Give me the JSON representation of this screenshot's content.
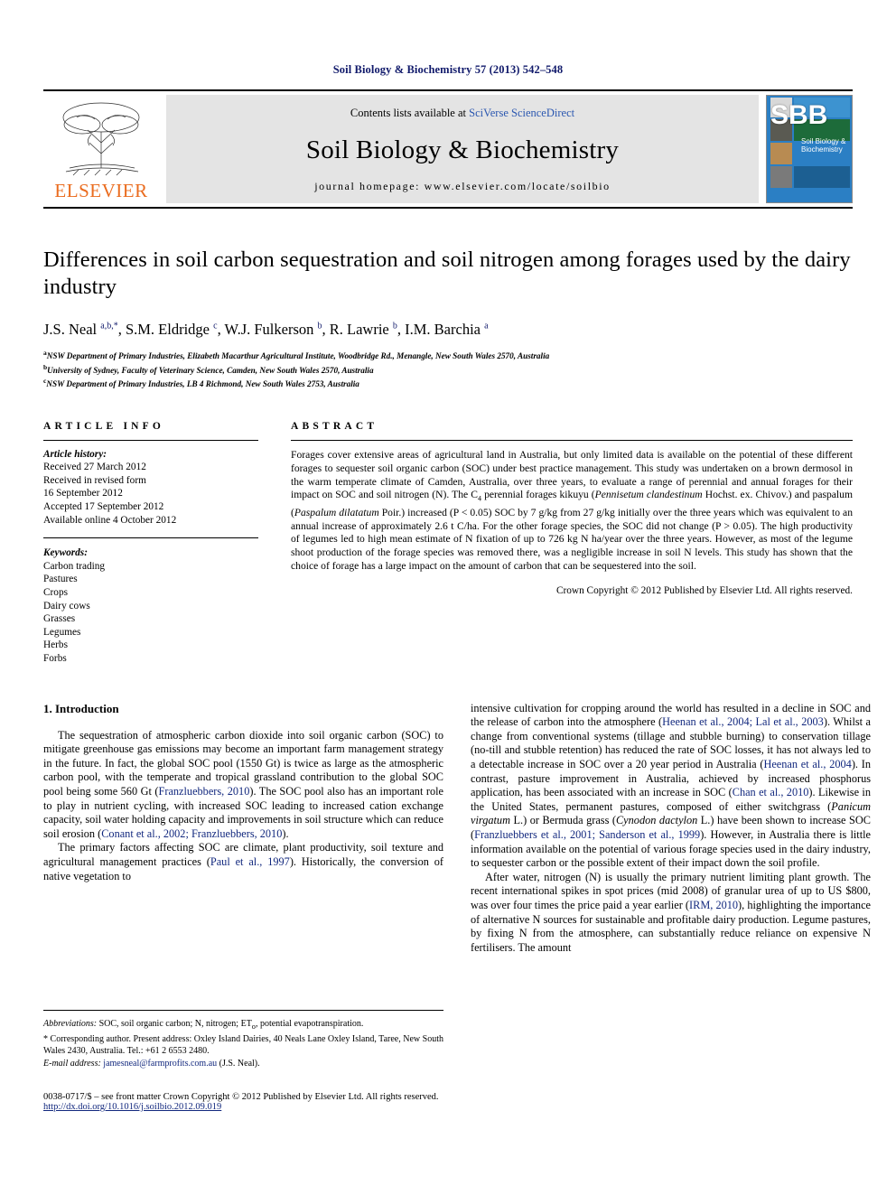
{
  "running_head": "Soil Biology & Biochemistry 57 (2013) 542–548",
  "masthead": {
    "publisher_name": "ELSEVIER",
    "publisher_logo_alt": "elsevier-tree-logo",
    "contents_prefix": "Contents lists available at ",
    "contents_link": "SciVerse ScienceDirect",
    "journal_name": "Soil Biology & Biochemistry",
    "homepage": "journal homepage: www.elsevier.com/locate/soilbio",
    "cover": {
      "initials": "SBB",
      "title_line1": "Soil Biology &",
      "title_line2": "Biochemistry"
    }
  },
  "article": {
    "title": "Differences in soil carbon sequestration and soil nitrogen among forages used by the dairy industry",
    "authors_html": "J.S. Neal <sup>a,b,</sup><sup>*</sup>, S.M. Eldridge <sup>c</sup>, W.J. Fulkerson <sup>b</sup>, R. Lawrie <sup>b</sup>, I.M. Barchia <sup>a</sup>",
    "affiliations": [
      {
        "marker": "a",
        "text": "NSW Department of Primary Industries, Elizabeth Macarthur Agricultural Institute, Woodbridge Rd., Menangle, New South Wales 2570, Australia"
      },
      {
        "marker": "b",
        "text": "University of Sydney, Faculty of Veterinary Science, Camden, New South Wales 2570, Australia"
      },
      {
        "marker": "c",
        "text": "NSW Department of Primary Industries, LB 4 Richmond, New South Wales 2753, Australia"
      }
    ]
  },
  "article_info": {
    "heading": "ARTICLE INFO",
    "history_label": "Article history:",
    "history": [
      "Received 27 March 2012",
      "Received in revised form",
      "16 September 2012",
      "Accepted 17 September 2012",
      "Available online 4 October 2012"
    ],
    "keywords_label": "Keywords:",
    "keywords": [
      "Carbon trading",
      "Pastures",
      "Crops",
      "Dairy cows",
      "Grasses",
      "Legumes",
      "Herbs",
      "Forbs"
    ]
  },
  "abstract": {
    "heading": "ABSTRACT",
    "paragraph_html": "Forages cover extensive areas of agricultural land in Australia, but only limited data is available on the potential of these different forages to sequester soil organic carbon (SOC) under best practice management. This study was undertaken on a brown dermosol in the warm temperate climate of Camden, Australia, over three years, to evaluate a range of perennial and annual forages for their impact on SOC and soil nitrogen (N). The C<sub>4</sub> perennial forages kikuyu (<i>Pennisetum clandestinum</i> Hochst. ex. Chivov.) and paspalum (<i>Paspalum dilatatum</i> Poir.) increased (P &lt; 0.05) SOC by 7 g/kg from 27 g/kg initially over the three years which was equivalent to an annual increase of approximately 2.6 t C/ha. For the other forage species, the SOC did not change (P &gt; 0.05). The high productivity of legumes led to high mean estimate of N fixation of up to 726 kg N ha/year over the three years. However, as most of the legume shoot production of the forage species was removed there, was a negligible increase in soil N levels. This study has shown that the choice of forage has a large impact on the amount of carbon that can be sequestered into the soil.",
    "copyright": "Crown Copyright © 2012 Published by Elsevier Ltd. All rights reserved."
  },
  "introduction": {
    "heading": "1. Introduction",
    "left_paragraphs_html": [
      "The sequestration of atmospheric carbon dioxide into soil organic carbon (SOC) to mitigate greenhouse gas emissions may become an important farm management strategy in the future. In fact, the global SOC pool (1550 Gt) is twice as large as the atmospheric carbon pool, with the temperate and tropical grassland contribution to the global SOC pool being some 560 Gt (<span class=\"cite\">Franzluebbers, 2010</span>). The SOC pool also has an important role to play in nutrient cycling, with increased SOC leading to increased cation exchange capacity, soil water holding capacity and improvements in soil structure which can reduce soil erosion (<span class=\"cite\">Conant et al., 2002; Franzluebbers, 2010</span>).",
      "The primary factors affecting SOC are climate, plant productivity, soil texture and agricultural management practices (<span class=\"cite\">Paul et al., 1997</span>). Historically, the conversion of native vegetation to"
    ],
    "right_paragraphs_html": [
      "intensive cultivation for cropping around the world has resulted in a decline in SOC and the release of carbon into the atmosphere (<span class=\"cite\">Heenan et al., 2004; Lal et al., 2003</span>). Whilst a change from conventional systems (tillage and stubble burning) to conservation tillage (no-till and stubble retention) has reduced the rate of SOC losses, it has not always led to a detectable increase in SOC over a 20 year period in Australia (<span class=\"cite\">Heenan et al., 2004</span>). In contrast, pasture improvement in Australia, achieved by increased phosphorus application, has been associated with an increase in SOC (<span class=\"cite\">Chan et al., 2010</span>). Likewise in the United States, permanent pastures, composed of either switchgrass (<span class=\"ital\">Panicum virgatum</span> L.) or Bermuda grass (<span class=\"ital\">Cynodon dactylon</span> L.) have been shown to increase SOC (<span class=\"cite\">Franzluebbers et al., 2001; Sanderson et al., 1999</span>). However, in Australia there is little information available on the potential of various forage species used in the dairy industry, to sequester carbon or the possible extent of their impact down the soil profile.",
      "After water, nitrogen (N) is usually the primary nutrient limiting plant growth. The recent international spikes in spot prices (mid 2008) of granular urea of up to US $800, was over four times the price paid a year earlier (<span class=\"cite\">IRM, 2010</span>), highlighting the importance of alternative N sources for sustainable and profitable dairy production. Legume pastures, by fixing N from the atmosphere, can substantially reduce reliance on expensive N fertilisers. The amount"
    ]
  },
  "footnotes": {
    "abbreviations_html": "<span class=\"it\">Abbreviations:</span> SOC, soil organic carbon; N, nitrogen; ET<sub>o</sub>, potential evapotranspiration.",
    "corresponding_html": "* Corresponding author. Present address: Oxley Island Dairies, 40 Neals Lane Oxley Island, Taree, New South Wales 2430, Australia. Tel.: +61 2 6553 2480.",
    "email_html": "<span class=\"it\">E-mail address:</span> <span class=\"link\">jamesneal@farmprofits.com.au</span> (J.S. Neal)."
  },
  "page_footer": {
    "front_matter": "0038-0717/$ – see front matter Crown Copyright © 2012 Published by Elsevier Ltd. All rights reserved.",
    "doi": "http://dx.doi.org/10.1016/j.soilbio.2012.09.019"
  }
}
